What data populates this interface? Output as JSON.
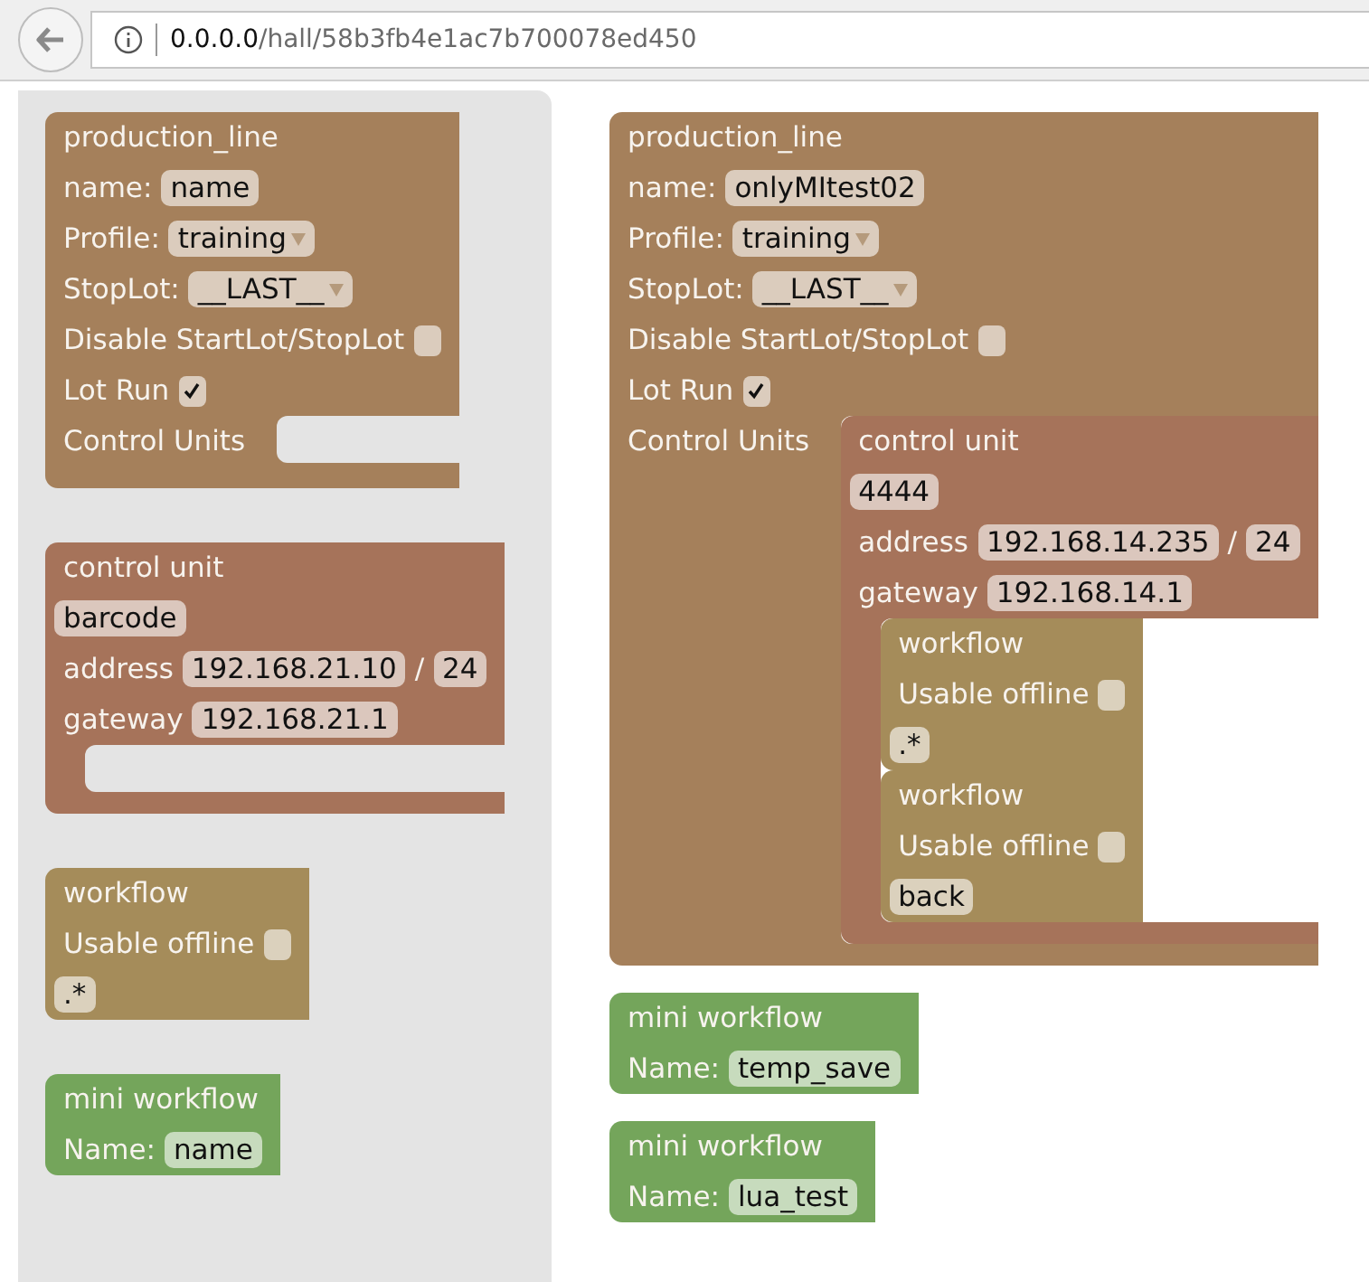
{
  "address_bar": {
    "host": "0.0.0.0",
    "path": "/hall/58b3fb4e1ac7b700078ed450"
  },
  "toolbox": {
    "blocks": [
      {
        "kind": "production_line",
        "rows": [
          {
            "kind": "fields",
            "items": [
              {
                "kind": "label",
                "text": "production_line"
              }
            ]
          },
          {
            "kind": "fields",
            "items": [
              {
                "kind": "label",
                "text": "name:"
              },
              {
                "kind": "input",
                "text": "name"
              }
            ]
          },
          {
            "kind": "fields",
            "items": [
              {
                "kind": "label",
                "text": "Profile:"
              },
              {
                "kind": "dropdown",
                "text": "training"
              }
            ]
          },
          {
            "kind": "fields",
            "items": [
              {
                "kind": "label",
                "text": "StopLot:"
              },
              {
                "kind": "dropdown",
                "text": "__LAST__"
              }
            ]
          },
          {
            "kind": "fields",
            "items": [
              {
                "kind": "label",
                "text": "Disable StartLot/StopLot"
              },
              {
                "kind": "checkbox",
                "checked": false
              }
            ]
          },
          {
            "kind": "fields",
            "items": [
              {
                "kind": "label",
                "text": "Lot Run"
              },
              {
                "kind": "checkbox",
                "checked": true
              }
            ]
          },
          {
            "kind": "statement",
            "label": "Control Units"
          }
        ]
      },
      {
        "kind": "control_unit",
        "rows": [
          {
            "kind": "fields",
            "items": [
              {
                "kind": "label",
                "text": "control unit"
              }
            ]
          },
          {
            "kind": "value",
            "items": [
              {
                "kind": "input",
                "text": "barcode"
              }
            ]
          },
          {
            "kind": "fields",
            "items": [
              {
                "kind": "label",
                "text": "address"
              },
              {
                "kind": "input",
                "text": "192.168.21.10"
              },
              {
                "kind": "label",
                "text": "/"
              },
              {
                "kind": "input",
                "text": "24"
              }
            ]
          },
          {
            "kind": "fields",
            "items": [
              {
                "kind": "label",
                "text": "gateway"
              },
              {
                "kind": "input",
                "text": "192.168.21.1"
              }
            ]
          },
          {
            "kind": "statement"
          }
        ]
      },
      {
        "kind": "workflow",
        "rows": [
          {
            "kind": "fields",
            "items": [
              {
                "kind": "label",
                "text": "workflow"
              }
            ]
          },
          {
            "kind": "fields",
            "items": [
              {
                "kind": "label",
                "text": "Usable offline"
              },
              {
                "kind": "checkbox",
                "checked": false
              }
            ]
          },
          {
            "kind": "value",
            "items": [
              {
                "kind": "input",
                "text": ".*"
              }
            ]
          }
        ]
      },
      {
        "kind": "mini_workflow",
        "rows": [
          {
            "kind": "fields",
            "items": [
              {
                "kind": "label",
                "text": "mini workflow"
              }
            ]
          },
          {
            "kind": "fields",
            "items": [
              {
                "kind": "label",
                "text": "Name:"
              },
              {
                "kind": "input",
                "text": "name"
              }
            ]
          }
        ]
      }
    ]
  },
  "workspace": {
    "blocks": [
      {
        "kind": "production_line",
        "rows": [
          {
            "kind": "fields",
            "items": [
              {
                "kind": "label",
                "text": "production_line"
              }
            ]
          },
          {
            "kind": "fields",
            "items": [
              {
                "kind": "label",
                "text": "name:"
              },
              {
                "kind": "input",
                "text": "onlyMItest02"
              }
            ]
          },
          {
            "kind": "fields",
            "items": [
              {
                "kind": "label",
                "text": "Profile:"
              },
              {
                "kind": "dropdown",
                "text": "training"
              }
            ]
          },
          {
            "kind": "fields",
            "items": [
              {
                "kind": "label",
                "text": "StopLot:"
              },
              {
                "kind": "dropdown",
                "text": "__LAST__"
              }
            ]
          },
          {
            "kind": "fields",
            "items": [
              {
                "kind": "label",
                "text": "Disable StartLot/StopLot"
              },
              {
                "kind": "checkbox",
                "checked": false
              }
            ]
          },
          {
            "kind": "fields",
            "items": [
              {
                "kind": "label",
                "text": "Lot Run"
              },
              {
                "kind": "checkbox",
                "checked": true
              }
            ]
          },
          {
            "kind": "statement",
            "label": "Control Units",
            "children": [
              {
                "kind": "control_unit",
                "rows": [
                  {
                    "kind": "fields",
                    "items": [
                      {
                        "kind": "label",
                        "text": "control unit"
                      }
                    ]
                  },
                  {
                    "kind": "value",
                    "items": [
                      {
                        "kind": "input",
                        "text": "4444"
                      }
                    ]
                  },
                  {
                    "kind": "fields",
                    "items": [
                      {
                        "kind": "label",
                        "text": "address"
                      },
                      {
                        "kind": "input",
                        "text": "192.168.14.235"
                      },
                      {
                        "kind": "label",
                        "text": "/"
                      },
                      {
                        "kind": "input",
                        "text": "24"
                      }
                    ]
                  },
                  {
                    "kind": "fields",
                    "items": [
                      {
                        "kind": "label",
                        "text": "gateway"
                      },
                      {
                        "kind": "input",
                        "text": "192.168.14.1"
                      }
                    ]
                  },
                  {
                    "kind": "statement",
                    "children": [
                      {
                        "kind": "workflow",
                        "rows": [
                          {
                            "kind": "fields",
                            "items": [
                              {
                                "kind": "label",
                                "text": "workflow"
                              }
                            ]
                          },
                          {
                            "kind": "fields",
                            "items": [
                              {
                                "kind": "label",
                                "text": "Usable offline"
                              },
                              {
                                "kind": "checkbox",
                                "checked": false
                              }
                            ]
                          },
                          {
                            "kind": "value",
                            "items": [
                              {
                                "kind": "input",
                                "text": ".*"
                              }
                            ]
                          }
                        ]
                      },
                      {
                        "kind": "workflow",
                        "rows": [
                          {
                            "kind": "fields",
                            "items": [
                              {
                                "kind": "label",
                                "text": "workflow"
                              }
                            ]
                          },
                          {
                            "kind": "fields",
                            "items": [
                              {
                                "kind": "label",
                                "text": "Usable offline"
                              },
                              {
                                "kind": "checkbox",
                                "checked": false
                              }
                            ]
                          },
                          {
                            "kind": "value",
                            "items": [
                              {
                                "kind": "input",
                                "text": "back"
                              }
                            ]
                          }
                        ]
                      }
                    ]
                  }
                ]
              }
            ]
          }
        ]
      },
      {
        "kind": "mini_workflow",
        "rows": [
          {
            "kind": "fields",
            "items": [
              {
                "kind": "label",
                "text": "mini workflow"
              }
            ]
          },
          {
            "kind": "fields",
            "items": [
              {
                "kind": "label",
                "text": "Name:"
              },
              {
                "kind": "input",
                "text": "temp_save"
              }
            ]
          }
        ]
      },
      {
        "kind": "mini_workflow",
        "rows": [
          {
            "kind": "fields",
            "items": [
              {
                "kind": "label",
                "text": "mini workflow"
              }
            ]
          },
          {
            "kind": "fields",
            "items": [
              {
                "kind": "label",
                "text": "Name:"
              },
              {
                "kind": "input",
                "text": "lua_test"
              }
            ]
          }
        ]
      }
    ]
  }
}
